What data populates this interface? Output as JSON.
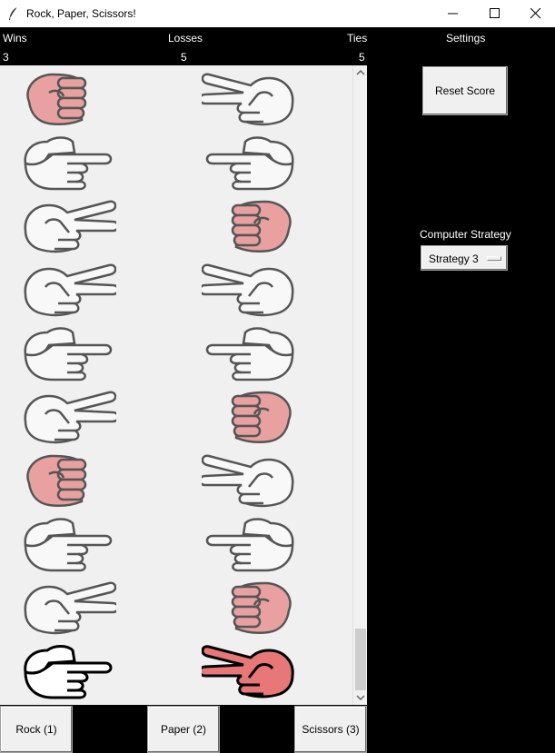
{
  "window": {
    "title": "Rock, Paper, Scissors!"
  },
  "score": {
    "wins_label": "Wins",
    "losses_label": "Losses",
    "ties_label": "Ties",
    "wins": "3",
    "losses": "5",
    "ties": "5"
  },
  "settings": {
    "header": "Settings",
    "reset_label": "Reset Score",
    "strategy_label": "Computer Strategy",
    "strategy_value": "Strategy 3"
  },
  "controls": {
    "rock_label": "Rock (1)",
    "paper_label": "Paper (2)",
    "scissors_label": "Scissors (3)"
  },
  "history": [
    {
      "player": "rock",
      "computer": "scissors",
      "latest": false
    },
    {
      "player": "paper",
      "computer": "paper",
      "latest": false
    },
    {
      "player": "scissors",
      "computer": "rock",
      "latest": false
    },
    {
      "player": "scissors",
      "computer": "scissors",
      "latest": false
    },
    {
      "player": "paper",
      "computer": "paper",
      "latest": false
    },
    {
      "player": "scissors",
      "computer": "rock",
      "latest": false
    },
    {
      "player": "rock",
      "computer": "scissors",
      "latest": false
    },
    {
      "player": "paper",
      "computer": "paper",
      "latest": false
    },
    {
      "player": "scissors",
      "computer": "rock",
      "latest": false
    },
    {
      "player": "paper",
      "computer": "scissors",
      "latest": true
    }
  ],
  "colors": {
    "hand_fill": "#f8f8f8",
    "hand_stroke": "#555555",
    "rock_fill": "#e8a0a0",
    "latest_stroke": "#000000",
    "latest_fill_red": "#e87878"
  }
}
